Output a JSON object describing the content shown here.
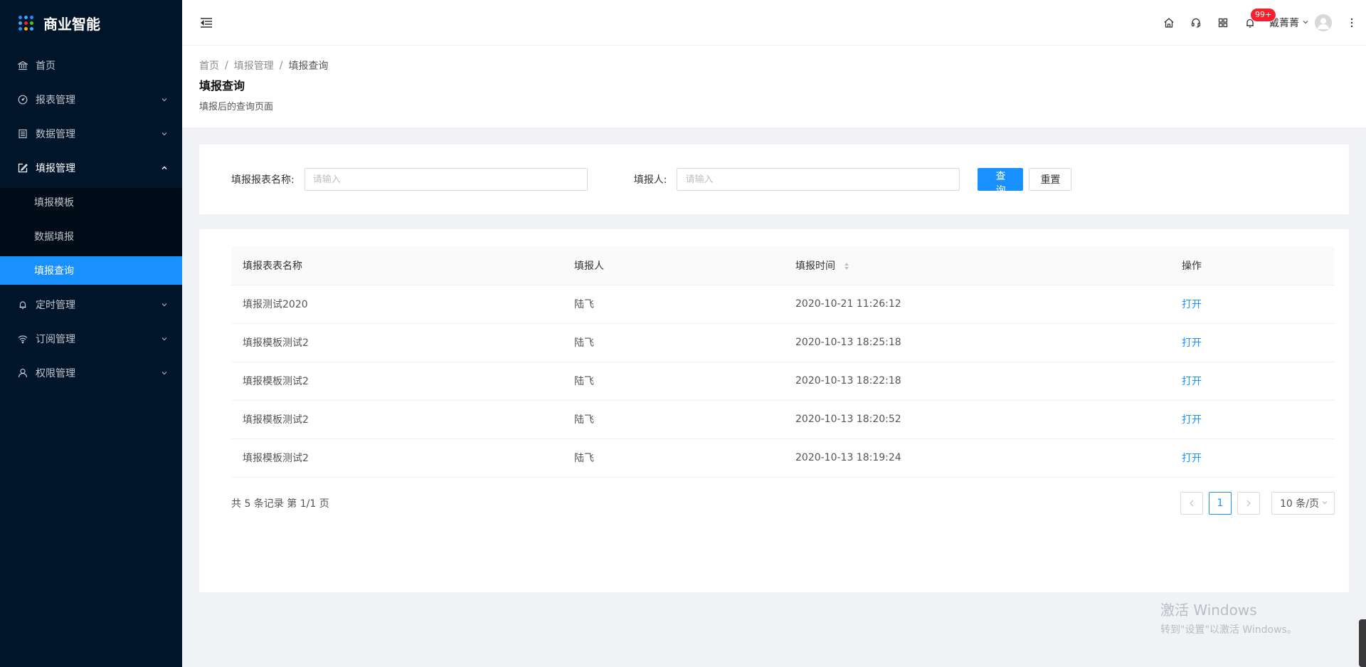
{
  "app": {
    "title": "商业智能"
  },
  "sidebar": {
    "items": [
      {
        "label": "首页",
        "icon": "bank-icon",
        "has_children": false
      },
      {
        "label": "报表管理",
        "icon": "dashboard-icon",
        "has_children": true
      },
      {
        "label": "数据管理",
        "icon": "database-icon",
        "has_children": true
      },
      {
        "label": "填报管理",
        "icon": "form-edit-icon",
        "has_children": true,
        "open": true,
        "children": [
          {
            "label": "填报模板"
          },
          {
            "label": "数据填报"
          },
          {
            "label": "填报查询",
            "active": true
          }
        ]
      },
      {
        "label": "定时管理",
        "icon": "bell-icon",
        "has_children": true
      },
      {
        "label": "订阅管理",
        "icon": "wifi-icon",
        "has_children": true
      },
      {
        "label": "权限管理",
        "icon": "user-icon",
        "has_children": true
      }
    ]
  },
  "header": {
    "notification_count": "99+",
    "user_name": "戴菁菁"
  },
  "page": {
    "breadcrumb": [
      "首页",
      "填报管理",
      "填报查询"
    ],
    "title": "填报查询",
    "description": "填报后的查询页面"
  },
  "search": {
    "report_name_label": "填报报表名称:",
    "report_name_placeholder": "请输入",
    "reporter_label": "填报人:",
    "reporter_placeholder": "请输入",
    "query_button": "查 询",
    "reset_button": "重置"
  },
  "table": {
    "columns": [
      "填报表表名称",
      "填报人",
      "填报时间",
      "操作"
    ],
    "rows": [
      {
        "name": "填报测试2020",
        "reporter": "陆飞",
        "time": "2020-10-21 11:26:12",
        "action": "打开"
      },
      {
        "name": "填报模板测试2",
        "reporter": "陆飞",
        "time": "2020-10-13 18:25:18",
        "action": "打开"
      },
      {
        "name": "填报模板测试2",
        "reporter": "陆飞",
        "time": "2020-10-13 18:22:18",
        "action": "打开"
      },
      {
        "name": "填报模板测试2",
        "reporter": "陆飞",
        "time": "2020-10-13 18:20:52",
        "action": "打开"
      },
      {
        "name": "填报模板测试2",
        "reporter": "陆飞",
        "time": "2020-10-13 18:19:24",
        "action": "打开"
      }
    ]
  },
  "pagination": {
    "total_text": "共 5 条记录 第 1/1 页",
    "current_page": "1",
    "page_size": "10 条/页"
  },
  "watermark": {
    "title": "激活 Windows",
    "subtitle": "转到\"设置\"以激活 Windows。"
  },
  "colors": {
    "sidebar_bg": "#001529",
    "submenu_bg": "#000c17",
    "primary": "#1890ff",
    "badge": "#f5222d"
  }
}
